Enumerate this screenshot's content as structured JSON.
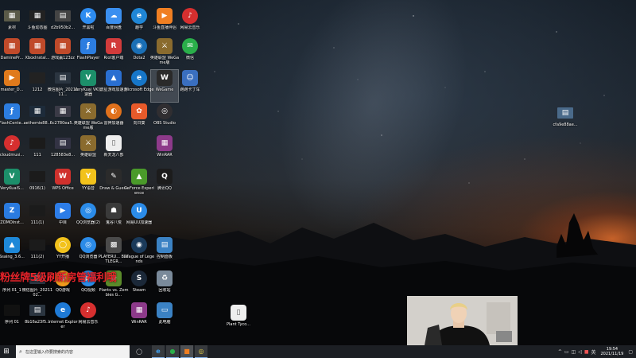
{
  "overlay_text": "粉丝牌5级刷新房管福利哦",
  "desktop_icons": [
    {
      "label": "素材",
      "glyph": "▦",
      "bg": "#5a5a48",
      "style": "thumb",
      "interactable": true
    },
    {
      "label": "斗鱼动态图",
      "glyph": "▦",
      "bg": "#222",
      "style": "thumb"
    },
    {
      "label": "d2b950b2...",
      "glyph": "▤",
      "bg": "#444",
      "style": "thumb"
    },
    {
      "label": "开黑啦",
      "glyph": "K",
      "bg": "#2d8cf0",
      "style": "round"
    },
    {
      "label": "百度网盘",
      "glyph": "☁",
      "bg": "#3a8ff0"
    },
    {
      "label": "趣学",
      "glyph": "e",
      "bg": "#1f86d6",
      "style": "round"
    },
    {
      "label": "斗鱼直播伴侣",
      "glyph": "▶",
      "bg": "#f07f22"
    },
    {
      "label": "网易云音乐",
      "glyph": "♪",
      "bg": "#d62f2f",
      "style": "round"
    },
    {
      "label": "DaminePr...",
      "glyph": "▦",
      "bg": "#c04a2a"
    },
    {
      "label": "XboxInstal...",
      "glyph": "▦",
      "bg": "#c04a2a"
    },
    {
      "label": "游戏赢123zz",
      "glyph": "▦",
      "bg": "#c04a2a"
    },
    {
      "label": "FlashPlayer",
      "glyph": "ƒ",
      "bg": "#2c7de0"
    },
    {
      "label": "Riot客户端",
      "glyph": "R",
      "bg": "#d23b3b"
    },
    {
      "label": "Dota2",
      "glyph": "◉",
      "bg": "#1a6fb5",
      "style": "round"
    },
    {
      "label": "英雄联盟 WeGame版",
      "glyph": "⚔",
      "bg": "#8a6b2e"
    },
    {
      "label": "微信",
      "glyph": "✉",
      "bg": "#2aae4a",
      "style": "round"
    },
    {
      "label": "master_D...",
      "glyph": "▶",
      "bg": "#e07a1c"
    },
    {
      "label": "1212",
      "glyph": "",
      "bg": "#222",
      "style": "thumb"
    },
    {
      "label": "微信图片_2021111...",
      "glyph": "▤",
      "bg": "#2b3540",
      "style": "thumb"
    },
    {
      "label": "VeryKuai VK加速器",
      "glyph": "V",
      "bg": "#1c8f6a"
    },
    {
      "label": "流星游戏加速器",
      "glyph": "▲",
      "bg": "#2a6fd1"
    },
    {
      "label": "Microsoft Edge",
      "glyph": "e",
      "bg": "#1676c8",
      "style": "round"
    },
    {
      "label": "WeGame",
      "glyph": "W",
      "bg": "#2a2a2a",
      "selected": true
    },
    {
      "label": "跑跑卡丁车",
      "glyph": "☺",
      "bg": "#3a6fbf"
    },
    {
      "label": "FlashCente...",
      "glyph": "ƒ",
      "bg": "#2c7de0"
    },
    {
      "label": "aethemie88...",
      "glyph": "▦",
      "bg": "#1d2b3a",
      "style": "thumb"
    },
    {
      "label": "6c2780ea5...",
      "glyph": "▦",
      "bg": "#3a3a46",
      "style": "thumb"
    },
    {
      "label": "英雄联盟 WeGame版",
      "glyph": "⚔",
      "bg": "#8a6b2e"
    },
    {
      "label": "雷神加速器",
      "glyph": "◐",
      "bg": "#e0711c",
      "style": "round"
    },
    {
      "label": "向日葵",
      "glyph": "✿",
      "bg": "#e85a2a"
    },
    {
      "label": "OBS Studio",
      "glyph": "◎",
      "bg": "#302e31",
      "style": "round"
    },
    {
      "label": "cloudmusi...",
      "glyph": "♪",
      "bg": "#d62f2f",
      "style": "round"
    },
    {
      "label": "111",
      "glyph": "",
      "bg": "#1b1b1b",
      "style": "thumb"
    },
    {
      "label": "128583e8...",
      "glyph": "▤",
      "bg": "#334",
      "style": "thumb"
    },
    {
      "label": "英雄联盟",
      "glyph": "⚔",
      "bg": "#8a6b2e"
    },
    {
      "label": "新天龙八部",
      "glyph": "▯",
      "bg": "#eeeeee"
    },
    {
      "label": "WinRAR",
      "glyph": "▦",
      "bg": "#8d3a8a"
    },
    {
      "label": "VeryKuaiS...",
      "glyph": "V",
      "bg": "#1c8f6a"
    },
    {
      "label": "0916(1)",
      "glyph": "",
      "bg": "#1b1b1b",
      "style": "thumb"
    },
    {
      "label": "WPS Office",
      "glyph": "W",
      "bg": "#d0312d"
    },
    {
      "label": "YY语音",
      "glyph": "Y",
      "bg": "#f2c21b"
    },
    {
      "label": "Draw & Guess",
      "glyph": "✎",
      "bg": "#2b2b2b"
    },
    {
      "label": "GeForce Experience",
      "glyph": "▲",
      "bg": "#4a9a2a"
    },
    {
      "label": "腾讯QQ",
      "glyph": "Q",
      "bg": "#1c1c1c"
    },
    {
      "label": "ZOMOInst...",
      "glyph": "Z",
      "bg": "#2a7be0"
    },
    {
      "label": "111(1)",
      "glyph": "",
      "bg": "#1b1b1b",
      "style": "thumb"
    },
    {
      "label": "中目",
      "glyph": "▶",
      "bg": "#2d7de8"
    },
    {
      "label": "QQ浏览器(2)",
      "glyph": "◎",
      "bg": "#2b8be8",
      "style": "round"
    },
    {
      "label": "鬼谷八荒",
      "glyph": "☗",
      "bg": "#3a3a3a"
    },
    {
      "label": "网易UU加速器",
      "glyph": "U",
      "bg": "#2b8be8",
      "style": "round"
    },
    {
      "label": "Ssaing_3.6...",
      "glyph": "▲",
      "bg": "#1e88d8"
    },
    {
      "label": "111(2)",
      "glyph": "",
      "bg": "#1b1b1b",
      "style": "thumb"
    },
    {
      "label": "YY开播",
      "glyph": "◯",
      "bg": "#f2c21b",
      "style": "round"
    },
    {
      "label": "QQ浏览器",
      "glyph": "◎",
      "bg": "#2b8be8",
      "style": "round"
    },
    {
      "label": "PLAYERU... BATTLEGR...",
      "glyph": "▩",
      "bg": "#4a4a4a"
    },
    {
      "label": "League of Legends",
      "glyph": "◉",
      "bg": "#1a3a5a",
      "style": "round"
    },
    {
      "label": "控制面板",
      "glyph": "▤",
      "bg": "#3b82c4"
    },
    {
      "label": "序列 01_1",
      "glyph": "",
      "bg": "#111",
      "style": "thumb"
    },
    {
      "label": "微信图片_2021102...",
      "glyph": "▤",
      "bg": "#2b3540",
      "style": "thumb"
    },
    {
      "label": "QQ游戏",
      "glyph": "☻",
      "bg": "#f09a1c",
      "style": "round"
    },
    {
      "label": "QQ视频",
      "glyph": "▶",
      "bg": "#2b8be8",
      "style": "round"
    },
    {
      "label": "Plants vs. Zombies G...",
      "glyph": "✿",
      "bg": "#5a8a2a"
    },
    {
      "label": "Steam",
      "glyph": "S",
      "bg": "#1b2838",
      "style": "round"
    },
    {
      "label": "回收站",
      "glyph": "♻",
      "bg": "#7a8a9a"
    },
    {
      "label": "序列 01",
      "glyph": "",
      "bg": "#111",
      "style": "thumb"
    },
    {
      "label": "8b16a23f5...",
      "glyph": "▤",
      "bg": "#2b3540",
      "style": "thumb"
    },
    {
      "label": "Internet Explorer",
      "glyph": "e",
      "bg": "#1e7ad6",
      "style": "round"
    },
    {
      "label": "网易云音乐",
      "glyph": "♪",
      "bg": "#d62f2f",
      "style": "round"
    },
    {
      "label": "WinRAR",
      "glyph": "▦",
      "bg": "#8d3a8a"
    },
    {
      "label": "此电脑",
      "glyph": "▭",
      "bg": "#3b82c4"
    },
    {
      "label": "Plant Tyco...",
      "glyph": "▯",
      "bg": "#eeeeee"
    },
    {
      "label": "cfa9e88ae...",
      "glyph": "▤",
      "bg": "#4a6a8a",
      "style": "thumb"
    }
  ],
  "taskbar": {
    "search_placeholder": "在这里输入你要搜索的内容",
    "time": "19:54",
    "date": "2021/11/19",
    "pinned": [
      {
        "name": "start-button",
        "glyph": "⊞",
        "color": "#fff"
      },
      {
        "name": "task-view-button",
        "glyph": "❐",
        "color": "#ddd"
      },
      {
        "name": "edge-taskbar-icon",
        "glyph": "e",
        "color": "#3fa0f0"
      },
      {
        "name": "wechat-taskbar-icon",
        "glyph": "✉",
        "color": "#2aae4a"
      },
      {
        "name": "douyu-taskbar-icon",
        "glyph": "▶",
        "color": "#f07f22"
      },
      {
        "name": "obs-taskbar-icon",
        "glyph": "◎",
        "color": "#e6d24a"
      }
    ],
    "tray_glyphs": [
      "^",
      "⌨",
      "☁",
      "◑",
      "🔊",
      "英"
    ]
  },
  "colors": {
    "overlay_red": "#e8232a",
    "taskbar_bg": "#1c1f24"
  }
}
